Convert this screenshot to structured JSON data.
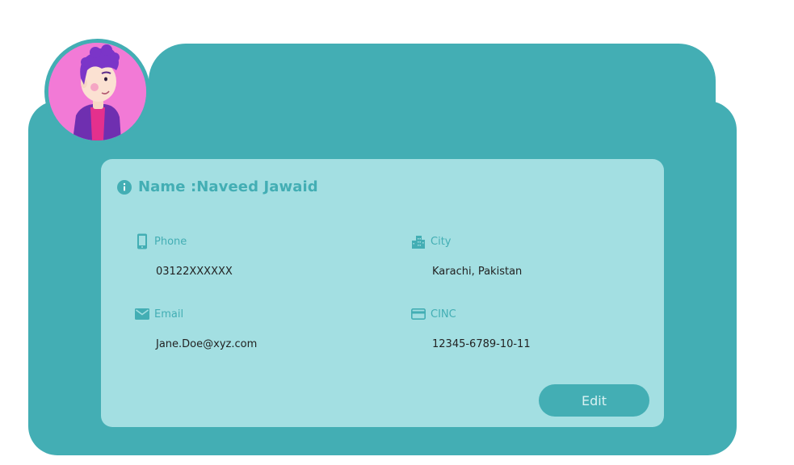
{
  "profile": {
    "name_label": "Name :",
    "name_value": "Naveed Jawaid",
    "avatar_icon": "cartoon-person-avatar"
  },
  "fields": {
    "phone": {
      "label": "Phone",
      "value": "03122XXXXXX",
      "icon": "phone-icon"
    },
    "city": {
      "label": "City",
      "value": "Karachi, Pakistan",
      "icon": "city-icon"
    },
    "email": {
      "label": "Email",
      "value": "Jane.Doe@xyz.com",
      "icon": "email-icon"
    },
    "cinc": {
      "label": "CINC",
      "value": "12345-6789-10-11",
      "icon": "card-icon"
    }
  },
  "actions": {
    "edit_label": "Edit"
  },
  "colors": {
    "accent": "#43aeb4",
    "panel": "#a3dfe2",
    "avatar_bg": "#f27ad6",
    "text_dark": "#222222"
  }
}
